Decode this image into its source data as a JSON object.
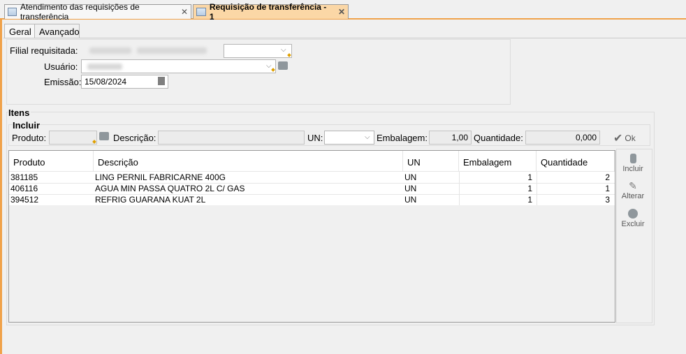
{
  "tabs": [
    {
      "label": "Atendimento das requisições de transferência",
      "close": "✕"
    },
    {
      "label": "Requisição de transferência - 1",
      "close": "✕"
    }
  ],
  "subtabs": [
    "Geral",
    "Avançado"
  ],
  "form": {
    "filial_label": "Filial requisitada:",
    "usuario_label": "Usuário:",
    "emissao_label": "Emissão:",
    "emissao_value": "15/08/2024"
  },
  "itens": {
    "title": "Itens",
    "incluir_title": "Incluir",
    "produto_label": "Produto:",
    "descricao_label": "Descrição:",
    "un_label": "UN:",
    "embalagem_label": "Embalagem:",
    "embalagem_value": "1,00",
    "quantidade_label": "Quantidade:",
    "quantidade_value": "0,000",
    "ok_label": "Ok"
  },
  "table": {
    "columns": [
      "Produto",
      "Descrição",
      "UN",
      "Embalagem",
      "Quantidade"
    ],
    "rows": [
      {
        "produto": "381185",
        "descricao": "LING PERNIL FABRICARNE 400G",
        "un": "UN",
        "embalagem": "1",
        "quantidade": "2"
      },
      {
        "produto": "406116",
        "descricao": "AGUA MIN PASSA QUATRO 2L C/ GAS",
        "un": "UN",
        "embalagem": "1",
        "quantidade": "1"
      },
      {
        "produto": "394512",
        "descricao": "REFRIG GUARANA KUAT 2L",
        "un": "UN",
        "embalagem": "1",
        "quantidade": "3"
      }
    ]
  },
  "actions": {
    "incluir": "Incluir",
    "alterar": "Alterar",
    "excluir": "Excluir"
  },
  "colors": {
    "accent": "#f0a24a",
    "active_tab": "#fbd7a6"
  }
}
